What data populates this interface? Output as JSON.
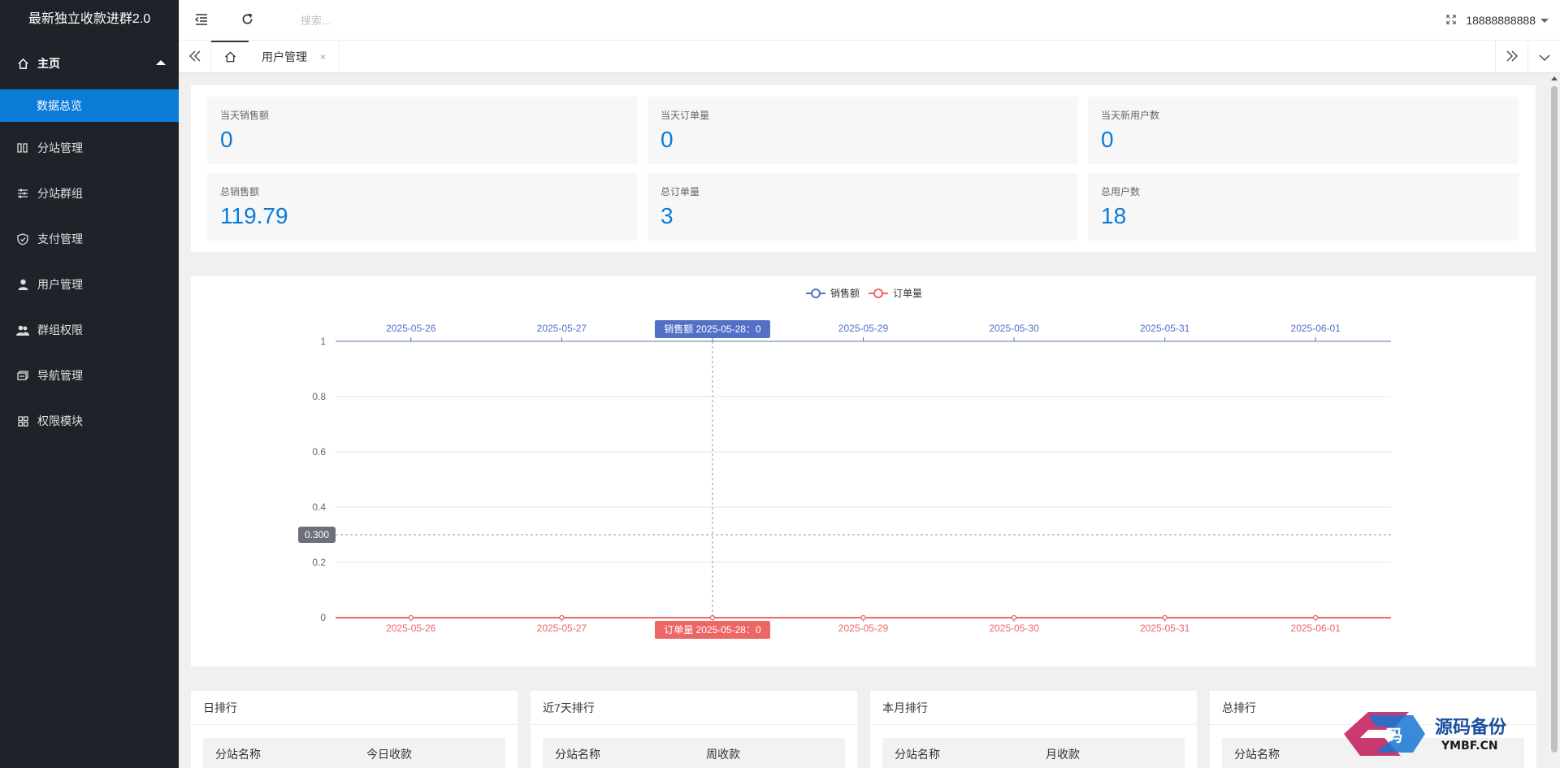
{
  "app": {
    "title": "最新独立收款进群2.0"
  },
  "sidebar": {
    "home": {
      "label": "主页",
      "icon": "home-icon"
    },
    "sub_items": [
      {
        "label": "数据总览"
      }
    ],
    "items": [
      {
        "label": "分站管理",
        "icon": "columns-icon"
      },
      {
        "label": "分站群组",
        "icon": "sliders-icon"
      },
      {
        "label": "支付管理",
        "icon": "shield-icon"
      },
      {
        "label": "用户管理",
        "icon": "user-icon"
      },
      {
        "label": "群组权限",
        "icon": "users-icon"
      },
      {
        "label": "导航管理",
        "icon": "nav-icon"
      },
      {
        "label": "权限模块",
        "icon": "grid-icon"
      }
    ]
  },
  "header": {
    "search_placeholder": "搜索...",
    "user": "18888888888"
  },
  "tabs": {
    "active_tab": "用户管理",
    "close": "×"
  },
  "stats": [
    {
      "label": "当天销售额",
      "value": "0"
    },
    {
      "label": "当天订单量",
      "value": "0"
    },
    {
      "label": "当天新用户数",
      "value": "0"
    },
    {
      "label": "总销售额",
      "value": "119.79"
    },
    {
      "label": "总订单量",
      "value": "3"
    },
    {
      "label": "总用户数",
      "value": "18"
    }
  ],
  "chart_data": {
    "type": "line",
    "x": [
      "2025-05-26",
      "2025-05-27",
      "2025-05-28",
      "2025-05-29",
      "2025-05-30",
      "2025-05-31",
      "2025-06-01"
    ],
    "series": [
      {
        "name": "销售额",
        "values": [
          0,
          0,
          0,
          0,
          0,
          0,
          0
        ],
        "color": "#5470c6"
      },
      {
        "name": "订单量",
        "values": [
          0,
          0,
          0,
          0,
          0,
          0,
          0
        ],
        "color": "#ee6666"
      }
    ],
    "ylim": [
      0,
      1
    ],
    "yticks": [
      "0",
      "0.2",
      "0.4",
      "0.6",
      "0.8",
      "1"
    ],
    "legend_position": "top-center",
    "grid": true,
    "crosshair": {
      "x_index": 2,
      "y_value": 0.3,
      "y_label": "0.300",
      "top_label": "销售额  2025-05-28：0",
      "bottom_label": "订单量  2025-05-28：0"
    }
  },
  "rankings": [
    {
      "title": "日排行",
      "col1": "分站名称",
      "col2": "今日收款"
    },
    {
      "title": "近7天排行",
      "col1": "分站名称",
      "col2": "周收款"
    },
    {
      "title": "本月排行",
      "col1": "分站名称",
      "col2": "月收款"
    },
    {
      "title": "总排行",
      "col1": "分站名称",
      "col2": ""
    }
  ],
  "watermark": {
    "text": "源码备份",
    "sub": "YMBF.CN",
    "glyph": "码"
  }
}
